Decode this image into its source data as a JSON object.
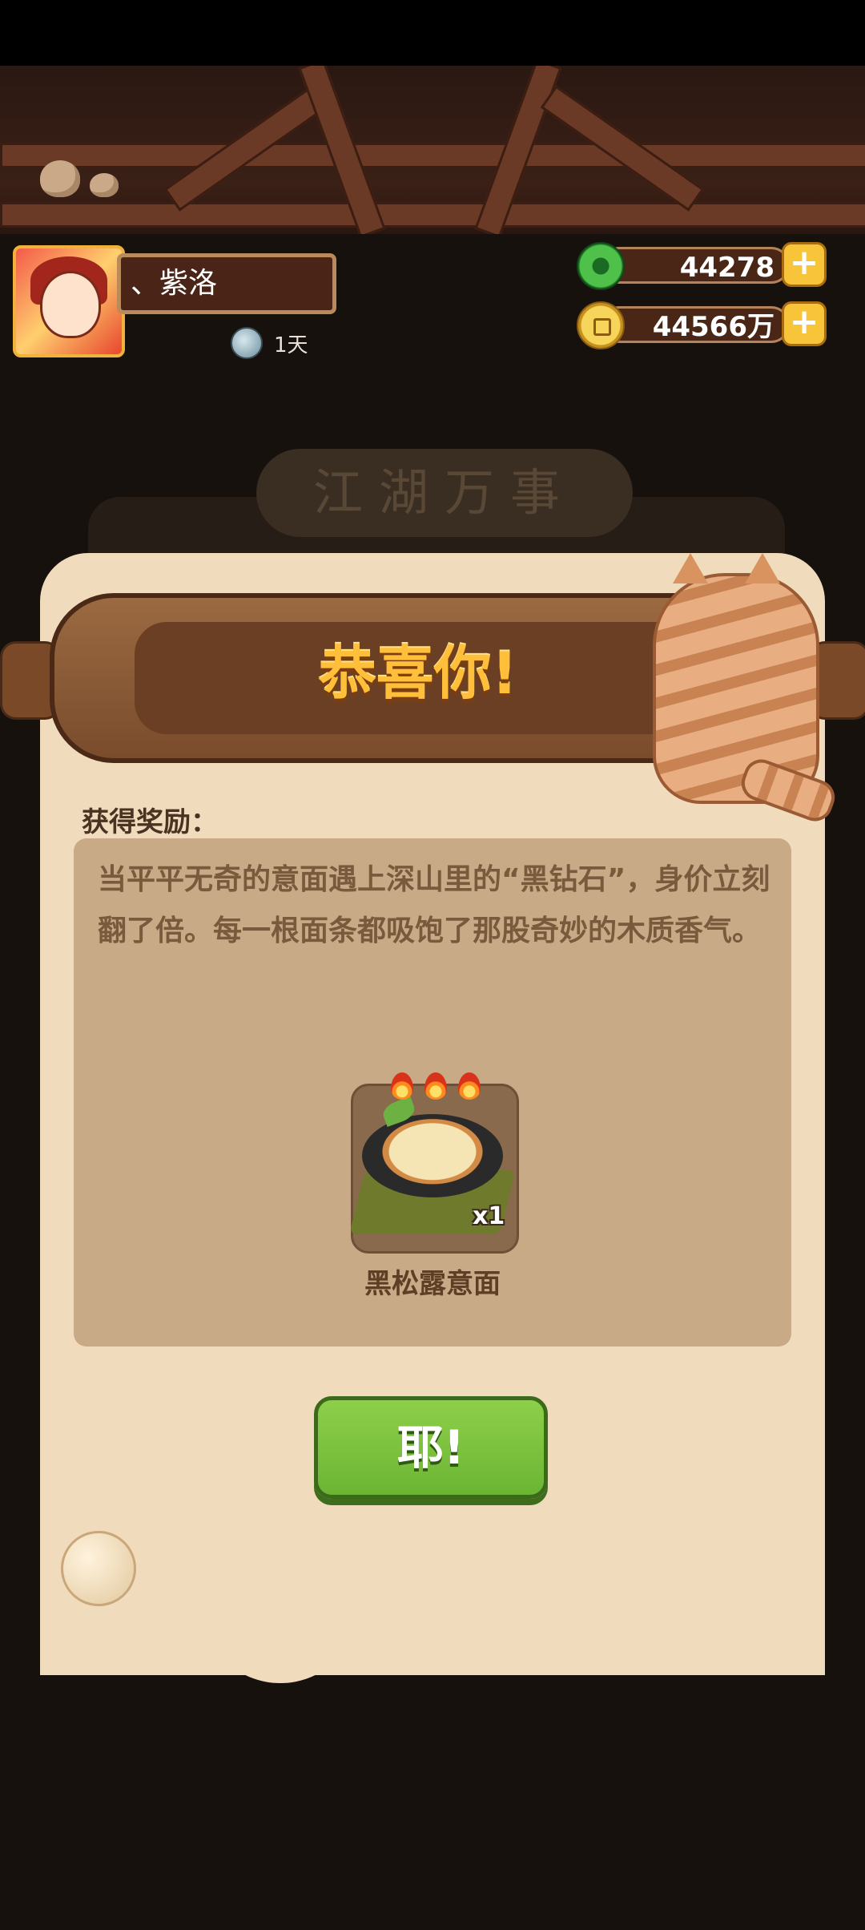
{
  "player": {
    "name": "、紫洛",
    "days_label": "1天"
  },
  "currencies": {
    "jade_amount": "44278",
    "coin_amount": "44566万",
    "plus_symbol": "+"
  },
  "background": {
    "board_title": "江湖万事"
  },
  "reward_dialog": {
    "title": "恭喜你!",
    "reward_label": "获得奖励：",
    "description": "当平平无奇的意面遇上深山里的“黑钻石”，身价立刻翻了倍。每一根面条都吸饱了那股奇妙的木质香气。",
    "item": {
      "name": "黑松露意面",
      "quantity": "x1",
      "heat_level": 3
    },
    "confirm_button": "耶!"
  },
  "colors": {
    "accent_gold": "#ffbf3a",
    "button_green": "#7cc23e",
    "parchment": "#f0dcbc"
  }
}
